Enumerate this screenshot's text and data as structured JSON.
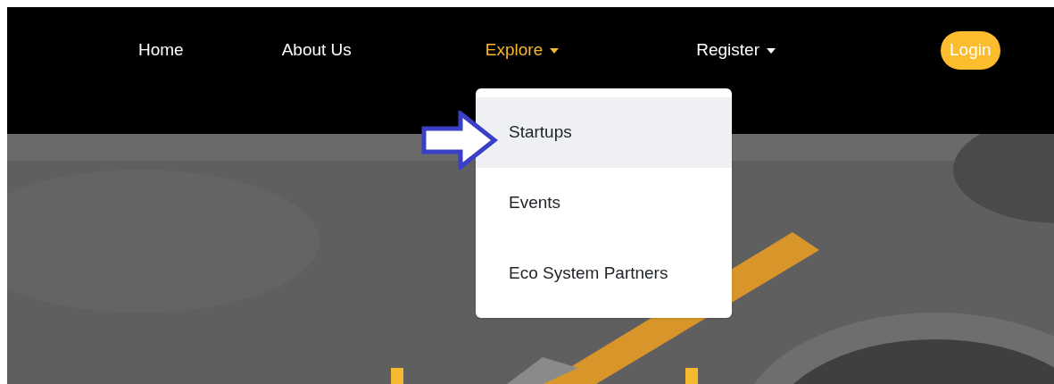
{
  "nav": {
    "items": [
      {
        "label": "Home",
        "kind": "link",
        "selected": false
      },
      {
        "label": "About Us",
        "kind": "link",
        "selected": false
      },
      {
        "label": "Explore",
        "kind": "dropdown",
        "selected": true
      },
      {
        "label": "Register",
        "kind": "dropdown",
        "selected": false
      }
    ],
    "login": {
      "label": "Login"
    }
  },
  "dropdown": {
    "items": [
      {
        "label": "Startups",
        "selected": true
      },
      {
        "label": "Events",
        "selected": false
      },
      {
        "label": "Eco System Partners",
        "selected": false
      }
    ]
  }
}
